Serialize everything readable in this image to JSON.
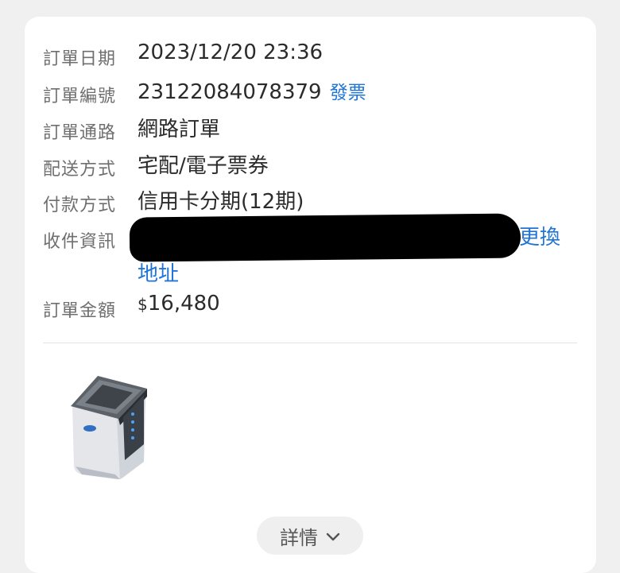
{
  "order": {
    "date": {
      "label": "訂單日期",
      "value": "2023/12/20 23:36"
    },
    "number": {
      "label": "訂單編號",
      "value": "23122084078379",
      "invoice_link": "發票"
    },
    "channel": {
      "label": "訂單通路",
      "value": "網路訂單"
    },
    "delivery": {
      "label": "配送方式",
      "value": "宅配/電子票券"
    },
    "payment": {
      "label": "付款方式",
      "value": "信用卡分期(12期)"
    },
    "recipient": {
      "label": "收件資訊",
      "change_link_line1": "更換",
      "change_link_line2": "地址"
    },
    "amount": {
      "label": "訂單金額",
      "currency": "$",
      "value": "16,480"
    }
  },
  "product": {
    "icon": "washing-machine-icon"
  },
  "details_button": {
    "label": "詳情",
    "icon": "chevron-down-icon"
  },
  "colors": {
    "link": "#1f74d6",
    "label": "#6f6f6f",
    "value": "#2b2b2b",
    "background": "#f0f0f0"
  }
}
